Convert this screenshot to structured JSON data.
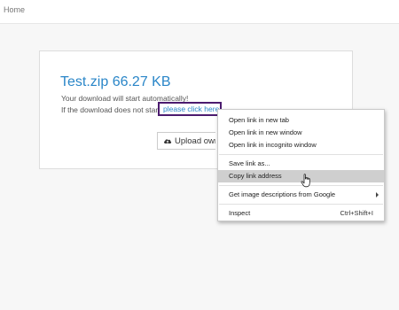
{
  "nav": {
    "home_label": "Home"
  },
  "download": {
    "title": "Test.zip 66.27 KB",
    "auto_message": "Your download will start automatically!",
    "fallback_message": "If the download does not start,",
    "link_text": "please click here",
    "upload_label": "Upload own",
    "upload_icon": "cloud-upload-icon"
  },
  "context_menu": {
    "items": [
      {
        "label": "Open link in new tab"
      },
      {
        "label": "Open link in new window"
      },
      {
        "label": "Open link in incognito window"
      },
      {
        "label": "Save link as..."
      },
      {
        "label": "Copy link address"
      },
      {
        "label": "Get image descriptions from Google"
      },
      {
        "label": "Inspect",
        "shortcut": "Ctrl+Shift+I"
      }
    ],
    "highlighted_item": "Copy link address"
  },
  "colors": {
    "accent": "#2a86c8",
    "link_outline": "#4b1b6f",
    "menu_highlight": "#cfcfcf"
  }
}
